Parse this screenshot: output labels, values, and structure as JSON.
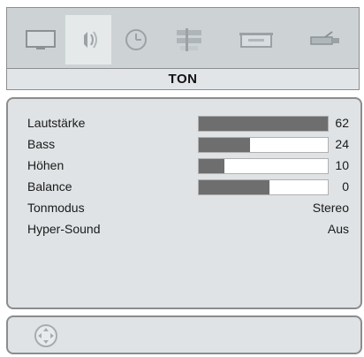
{
  "menu": {
    "tabs": [
      {
        "icon": "tv-screen-icon",
        "active": false
      },
      {
        "icon": "sound-icon",
        "active": true
      },
      {
        "icon": "clock-icon",
        "active": false
      },
      {
        "icon": "settings-icon",
        "active": false
      },
      {
        "icon": "source-icon",
        "active": false
      },
      {
        "icon": "usb-icon",
        "active": false
      }
    ],
    "title": "TON"
  },
  "settings": {
    "items": [
      {
        "label": "Lautstärke",
        "value": "62",
        "level": 1.0
      },
      {
        "label": "Bass",
        "value": "24",
        "level": 0.4
      },
      {
        "label": "Höhen",
        "value": "10",
        "level": 0.2
      },
      {
        "label": "Balance",
        "value": "0",
        "level": 0.55
      },
      {
        "label": "Tonmodus",
        "value": "Stereo"
      },
      {
        "label": "Hyper-Sound",
        "value": "Aus"
      }
    ]
  },
  "footer": {
    "icon": "navigation-dial-icon"
  },
  "colors": {
    "fill": "#6e6e6e",
    "panel": "#dfe3e5",
    "accent_border": "#8c8c8c"
  }
}
